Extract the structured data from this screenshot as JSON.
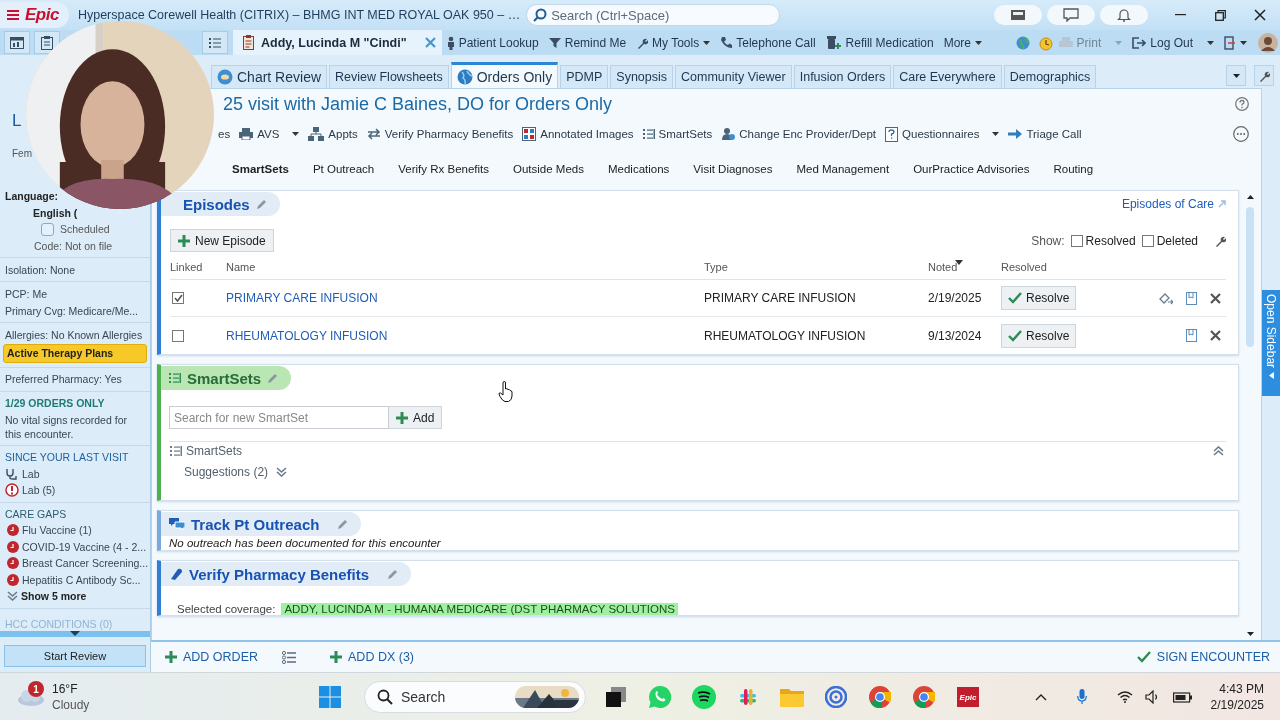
{
  "title_bar": {
    "logo": "Epic",
    "title": "Hyperspace Corewell Health (CITRIX) – BHMG INT MED ROYAL OAK 950 – …",
    "search": {
      "placeholder": "Search (Ctrl+Space)"
    }
  },
  "toolbar": {
    "patient_tab": {
      "label": "Addy, Lucinda M \"Cindi\""
    },
    "items": [
      {
        "label": "Patient Lookup",
        "menu": false
      },
      {
        "label": "Remind Me",
        "menu": false
      },
      {
        "label": "My Tools",
        "menu": true
      },
      {
        "label": "Telephone Call",
        "menu": false
      },
      {
        "label": "Refill Medication",
        "menu": false
      },
      {
        "label": "More",
        "menu": true
      }
    ],
    "right_items": [
      {
        "label": "Print",
        "disabled": true,
        "menu": true
      },
      {
        "label": "Log Out",
        "disabled": false,
        "menu": true
      }
    ]
  },
  "sidebar": {
    "patient_name": "L",
    "sex": "Fem",
    "groups": [
      {
        "items": [
          {
            "kind": "label",
            "text": "Language:"
          },
          {
            "kind": "value",
            "text": "English ("
          },
          {
            "kind": "checkbox",
            "text": "Scheduled",
            "checked": false
          },
          {
            "kind": "centered",
            "text": "Code: Not on file"
          }
        ]
      },
      {
        "items": [
          {
            "kind": "text",
            "text": "Isolation: None"
          }
        ]
      },
      {
        "items": [
          {
            "kind": "text",
            "text": "PCP: Me"
          },
          {
            "kind": "text",
            "text": "Primary Cvg: Medicare/Me..."
          }
        ]
      },
      {
        "items": [
          {
            "kind": "text",
            "text": "Allergies: No Known Allergies"
          },
          {
            "kind": "highlight",
            "text": "Active Therapy Plans"
          }
        ]
      },
      {
        "items": [
          {
            "kind": "text",
            "text": "Preferred Pharmacy: Yes"
          }
        ]
      },
      {
        "items": [
          {
            "kind": "encounter",
            "text": "1/29 ORDERS ONLY"
          },
          {
            "kind": "text",
            "text": "No vital signs recorded for this encounter."
          }
        ]
      },
      {
        "items": [
          {
            "kind": "heading",
            "text": "SINCE YOUR LAST VISIT"
          },
          {
            "kind": "result",
            "text": "Lab"
          },
          {
            "kind": "alert",
            "text": "Lab (5)"
          }
        ]
      },
      {
        "items": [
          {
            "kind": "subheading",
            "text": "CARE GAPS"
          },
          {
            "kind": "gap",
            "text": "Flu Vaccine (1)"
          },
          {
            "kind": "gap",
            "text": "COVID-19 Vaccine (4 - 2..."
          },
          {
            "kind": "gap",
            "text": "Breast Cancer Screening..."
          },
          {
            "kind": "gap",
            "text": "Hepatitis C Antibody Sc..."
          },
          {
            "kind": "more",
            "text": "Show 5 more"
          }
        ]
      }
    ],
    "bottom_heading": "HCC CONDITIONS (0)",
    "start_review": "Start Review"
  },
  "activity_tabs": [
    {
      "label": "Chart Review",
      "selected": false
    },
    {
      "label": "Review Flowsheets",
      "selected": false
    },
    {
      "label": "Orders Only",
      "selected": true
    },
    {
      "label": "PDMP",
      "selected": false
    },
    {
      "label": "Synopsis",
      "selected": false
    },
    {
      "label": "Community Viewer",
      "selected": false
    },
    {
      "label": "Infusion Orders",
      "selected": false
    },
    {
      "label": "Care Everywhere",
      "selected": false
    },
    {
      "label": "Demographics",
      "selected": false
    }
  ],
  "encounter": {
    "title": "25 visit with Jamie C Baines, DO for Orders Only",
    "actions": [
      {
        "label": "es",
        "menu": false
      },
      {
        "label": "AVS",
        "menu": true
      },
      {
        "label": "Appts",
        "menu": false
      },
      {
        "label": "Verify Pharmacy Benefits",
        "menu": false
      },
      {
        "label": "Annotated Images",
        "menu": false
      },
      {
        "label": "SmartSets",
        "menu": false
      },
      {
        "label": "Change Enc Provider/Dept",
        "menu": false
      },
      {
        "label": "Questionnaires",
        "menu": true
      },
      {
        "label": "Triage Call",
        "menu": false
      }
    ],
    "sections_nav": [
      {
        "label": "SmartSets",
        "selected": true
      },
      {
        "label": "Pt Outreach",
        "selected": false
      },
      {
        "label": "Verify Rx Benefits",
        "selected": false
      },
      {
        "label": "Outside Meds",
        "selected": false
      },
      {
        "label": "Medications",
        "selected": false
      },
      {
        "label": "Visit Diagnoses",
        "selected": false
      },
      {
        "label": "Med Management",
        "selected": false
      },
      {
        "label": "OurPractice Advisories",
        "selected": false
      },
      {
        "label": "Routing",
        "selected": false
      }
    ]
  },
  "episodes": {
    "title": "Episodes",
    "link": "Episodes of Care",
    "new_button": "New Episode",
    "show_label": "Show:",
    "filters": [
      {
        "label": "Resolved",
        "checked": false
      },
      {
        "label": "Deleted",
        "checked": false
      }
    ],
    "columns": [
      "Linked",
      "Name",
      "Type",
      "Noted",
      "Resolved"
    ],
    "rows": [
      {
        "linked": true,
        "name": "PRIMARY CARE INFUSION",
        "type": "PRIMARY CARE INFUSION",
        "noted": "2/19/2025",
        "action": "Resolve"
      },
      {
        "linked": false,
        "name": "RHEUMATOLOGY INFUSION",
        "type": "RHEUMATOLOGY INFUSION",
        "noted": "9/13/2024",
        "action": "Resolve"
      }
    ]
  },
  "smartsets": {
    "title": "SmartSets",
    "search": {
      "placeholder": "Search for new SmartSet"
    },
    "add_button": "Add",
    "list_label": "SmartSets",
    "suggestions": "Suggestions (2)"
  },
  "outreach": {
    "title": "Track Pt Outreach",
    "message": "No outreach has been documented for this encounter"
  },
  "pharmacy": {
    "title": "Verify Pharmacy Benefits",
    "coverage_label": "Selected coverage:",
    "coverage": "ADDY, LUCINDA M - HUMANA MEDICARE (DST PHARMACY SOLUTIONS"
  },
  "open_sidebar": "Open Sidebar",
  "action_bar": {
    "add_order": "ADD ORDER",
    "add_dx": "ADD DX (3)",
    "sign": "SIGN ENCOUNTER"
  },
  "taskbar": {
    "weather": {
      "badge": "1",
      "temperature": "16°F",
      "condition": "Cloudy"
    },
    "search": {
      "placeholder": "Search"
    },
    "app_label": "Epic",
    "time": "4:43 PM",
    "date": "2/19/2025"
  }
}
